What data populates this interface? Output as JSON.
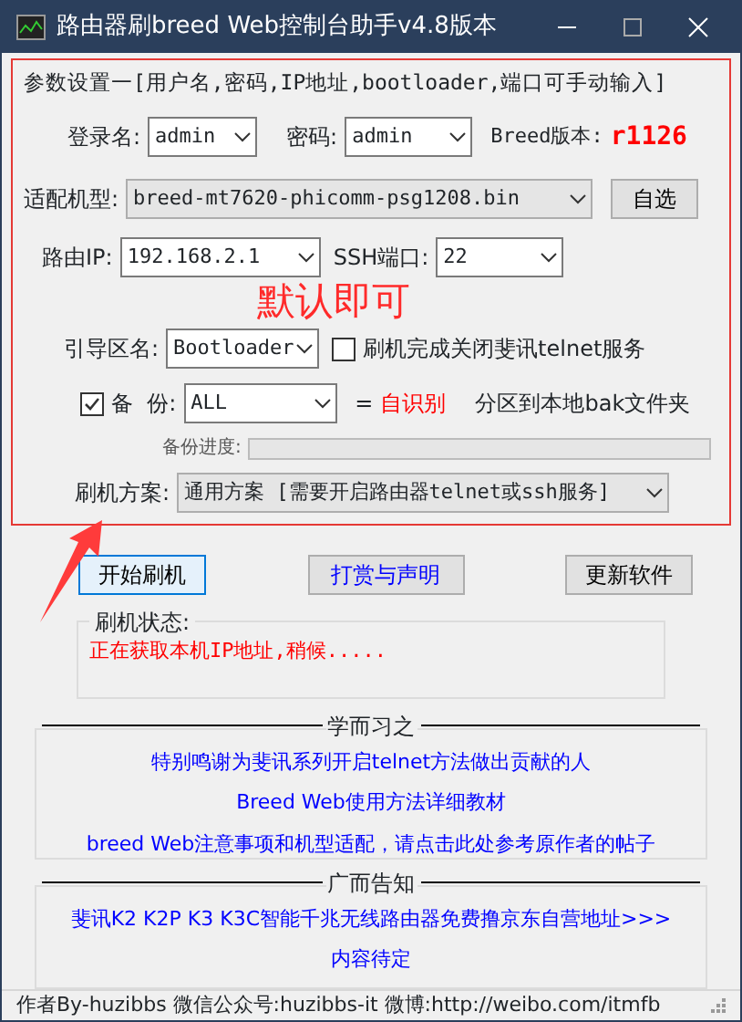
{
  "window": {
    "title": "路由器刷breed Web控制台助手v4.8版本"
  },
  "params": {
    "legend": "参数设置一[用户名,密码,IP地址,bootloader,端口可手动输入]",
    "login": {
      "label": "登录名:",
      "value": "admin"
    },
    "password": {
      "label": "密码:",
      "value": "admin"
    },
    "breed_version": {
      "label": "Breed版本:",
      "value": "r1126"
    },
    "model": {
      "label": "适配机型:",
      "value": "breed-mt7620-phicomm-psg1208.bin",
      "button": "自选"
    },
    "ip": {
      "label": "路由IP:",
      "value": "192.168.2.1"
    },
    "ssh_port": {
      "label": "SSH端口:",
      "value": "22"
    },
    "boot": {
      "label": "引导区名:",
      "value": "Bootloader"
    },
    "close_telnet": {
      "label": "刷机完成关闭斐讯telnet服务",
      "checked": false
    },
    "backup": {
      "label": "备  份:",
      "checked": true,
      "value": "ALL",
      "equals": "=",
      "auto": "自识别",
      "suffix": "分区到本地bak文件夹"
    },
    "progress": {
      "label": "备份进度:",
      "level": 0
    },
    "plan": {
      "label": "刷机方案:",
      "value": "通用方案 [需要开启路由器telnet或ssh服务]"
    }
  },
  "buttons": [
    {
      "label": "开始刷机",
      "kind": "focused"
    },
    {
      "label": "打赏与声明",
      "kind": "link"
    },
    {
      "label": "更新软件",
      "kind": "normal"
    }
  ],
  "status": {
    "legend": "刷机状态:",
    "message": "正在获取本机IP地址,稍候....."
  },
  "thanks": {
    "legend": "学而习之",
    "links": [
      "特别鸣谢为斐讯系列开启telnet方法做出贡献的人",
      "Breed Web使用方法详细教材",
      "breed Web注意事项和机型适配，请点击此处参考原作者的帖子"
    ]
  },
  "ads": {
    "legend": "广而告知",
    "links": [
      "斐讯K2  K2P  K3  K3C智能千兆无线路由器免费撸京东自营地址>>>",
      "内容待定"
    ]
  },
  "annotation": {
    "text": "默认即可"
  },
  "status_bar": "作者By-huzibbs 微信公众号:huzibbs-it 微博:http://weibo.com/itmfb"
}
